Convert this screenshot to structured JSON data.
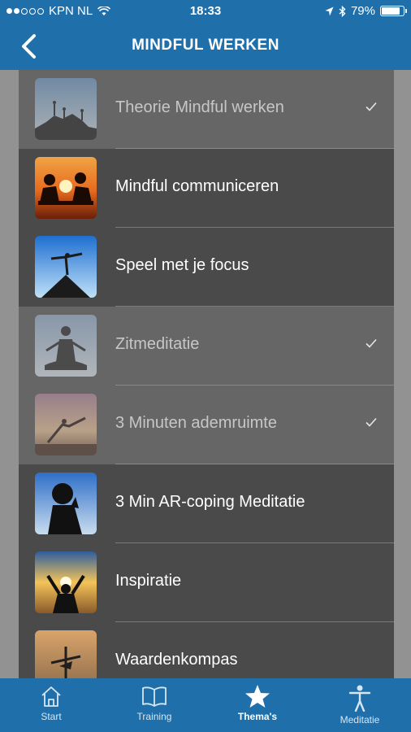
{
  "status": {
    "carrier": "KPN NL",
    "time": "18:33",
    "battery": "79%"
  },
  "header": {
    "title": "MINDFUL WERKEN"
  },
  "items": [
    {
      "label": "Theorie Mindful werken",
      "done": true
    },
    {
      "label": "Mindful communiceren",
      "done": false
    },
    {
      "label": "Speel met je focus",
      "done": false
    },
    {
      "label": "Zitmeditatie",
      "done": true
    },
    {
      "label": "3 Minuten ademruimte",
      "done": true
    },
    {
      "label": "3 Min AR-coping Meditatie",
      "done": false
    },
    {
      "label": "Inspiratie",
      "done": false
    },
    {
      "label": "Waardenkompas",
      "done": false
    }
  ],
  "tabs": [
    {
      "label": "Start",
      "icon": "home-icon",
      "active": false
    },
    {
      "label": "Training",
      "icon": "book-icon",
      "active": false
    },
    {
      "label": "Thema's",
      "icon": "star-icon",
      "active": true
    },
    {
      "label": "Meditatie",
      "icon": "person-icon",
      "active": false
    }
  ],
  "colors": {
    "bar": "#1f6fab",
    "row": "#4a4a4a",
    "row_done": "#666666"
  }
}
